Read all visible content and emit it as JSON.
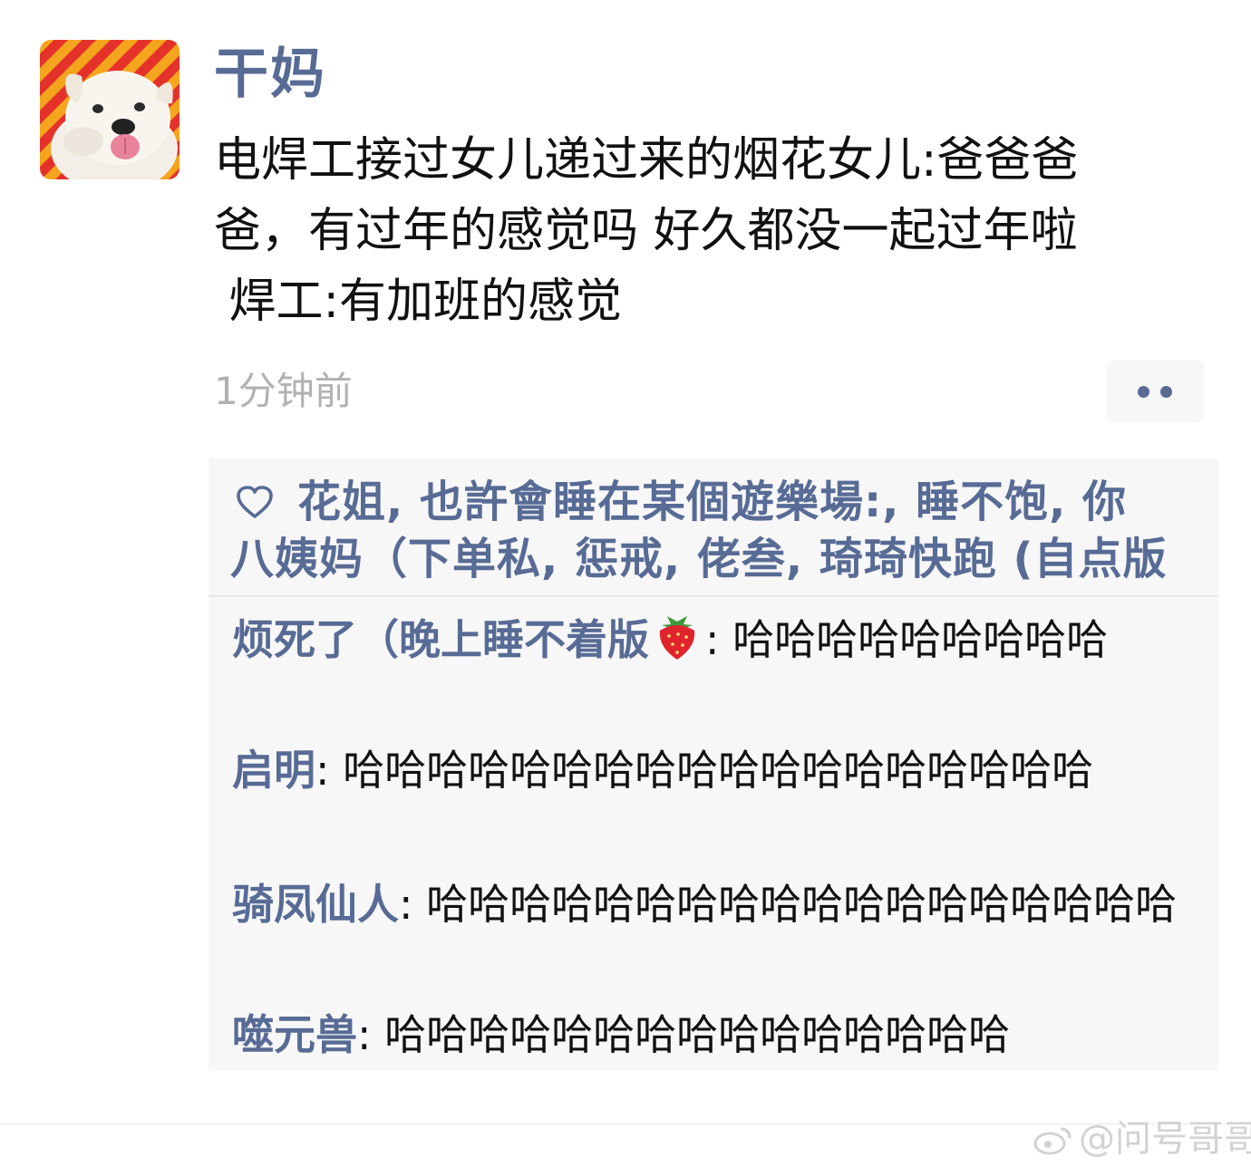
{
  "post": {
    "author": "干妈",
    "text_lines": [
      "电焊工接过女儿递过来的烟花女儿:爸爸爸",
      "爸，有过年的感觉吗 好久都没一起过年啦",
      " 焊工:有加班的感觉"
    ],
    "time": "1分钟前",
    "avatar_icon": "dog-avatar-icon"
  },
  "likes": {
    "icon": "heart-outline-icon",
    "line1": "花姐, 也許會睡在某個遊樂場:, 睡不饱, 你",
    "line2": "八姨妈（下单私, 惩戒, 佬叁, 琦琦快跑 (自点版"
  },
  "comments": [
    {
      "name": "烦死了（晚上睡不着版",
      "emoji": "strawberry-icon",
      "separator": ": ",
      "text": "哈哈哈哈哈哈哈哈哈"
    },
    {
      "name": "启明",
      "separator": ": ",
      "text": "哈哈哈哈哈哈哈哈哈哈哈哈哈哈哈哈哈哈"
    },
    {
      "name": "骑凤仙人",
      "separator": ": ",
      "text": "哈哈哈哈哈哈哈哈哈哈哈哈哈哈哈哈哈哈"
    },
    {
      "name": "噬元兽",
      "separator": ": ",
      "text": "哈哈哈哈哈哈哈哈哈哈哈哈哈哈哈"
    }
  ],
  "watermark": "@问号哥哥",
  "colors": {
    "link": "#576b95",
    "time": "#b2b2b2",
    "panel_bg": "#f7f7f7",
    "text": "#111111"
  }
}
